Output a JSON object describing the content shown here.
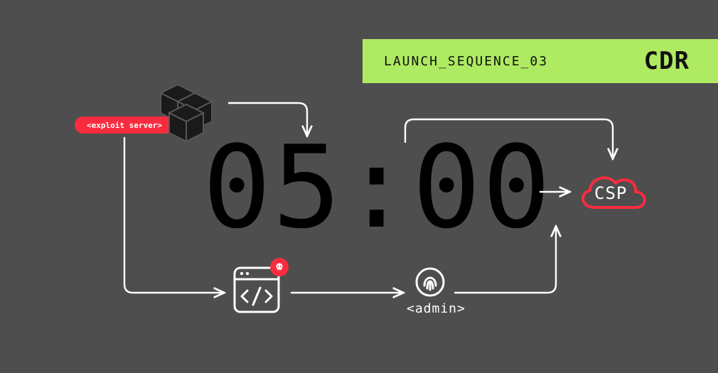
{
  "banner": {
    "sequence": "LAUNCH_SEQUENCE_03",
    "code": "CDR"
  },
  "timer": "05:00",
  "exploit_pill": "<exploit server>",
  "admin_label": "<admin>",
  "cloud_label": "CSP",
  "colors": {
    "bg": "#4e4e4e",
    "accent": "#afeb62",
    "danger": "#f92c3f",
    "stroke": "#ffffff"
  }
}
